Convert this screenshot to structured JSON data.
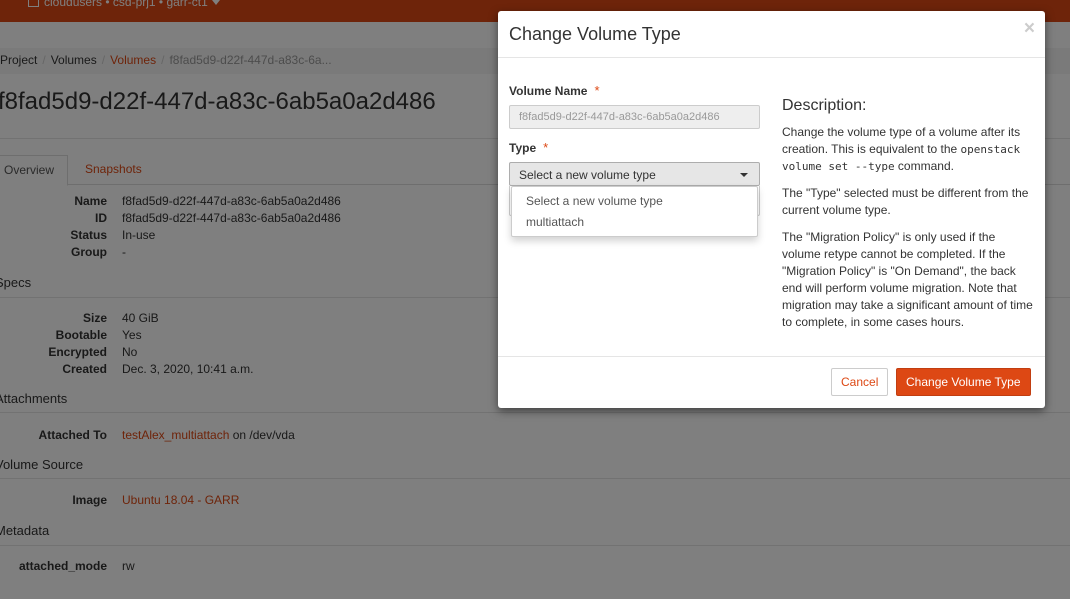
{
  "topbar": {
    "context": "cloudusers • csd-prj1 • garr-ct1"
  },
  "breadcrumb": {
    "items": [
      "Project",
      "Volumes",
      "Volumes"
    ],
    "current": "f8fad5d9-d22f-447d-a83c-6a..."
  },
  "page_title": "f8fad5d9-d22f-447d-a83c-6ab5a0a2d486",
  "tabs": {
    "overview": "Overview",
    "snapshots": "Snapshots"
  },
  "overview": {
    "name_label": "Name",
    "name_value": "f8fad5d9-d22f-447d-a83c-6ab5a0a2d486",
    "id_label": "ID",
    "id_value": "f8fad5d9-d22f-447d-a83c-6ab5a0a2d486",
    "status_label": "Status",
    "status_value": "In-use",
    "group_label": "Group",
    "group_value": "-",
    "specs_heading": "Specs",
    "size_label": "Size",
    "size_value": "40 GiB",
    "bootable_label": "Bootable",
    "bootable_value": "Yes",
    "encrypted_label": "Encrypted",
    "encrypted_value": "No",
    "created_label": "Created",
    "created_value": "Dec. 3, 2020, 10:41 a.m.",
    "attachments_heading": "Attachments",
    "attached_to_label": "Attached To",
    "attached_to_link": "testAlex_multiattach",
    "attached_to_suffix": " on /dev/vda",
    "volume_source_heading": "Volume Source",
    "image_label": "Image",
    "image_link": "Ubuntu 18.04 - GARR",
    "metadata_heading": "Metadata",
    "attached_mode_label": "attached_mode",
    "attached_mode_value": "rw"
  },
  "modal": {
    "title": "Change Volume Type",
    "close": "×",
    "volume_name_label": "Volume Name",
    "volume_name_value": "f8fad5d9-d22f-447d-a83c-6ab5a0a2d486",
    "required_marker": "*",
    "type_label": "Type",
    "type_selected": "Select a new volume type",
    "type_options": [
      "Select a new volume type",
      "multiattach"
    ],
    "description_heading": "Description:",
    "desc_p1_a": "Change the volume type of a volume after its creation. This is equivalent to the ",
    "desc_p1_code": "openstack volume set --type",
    "desc_p1_b": " command.",
    "desc_p2": "The \"Type\" selected must be different from the current volume type.",
    "desc_p3": "The \"Migration Policy\" is only used if the volume retype cannot be completed. If the \"Migration Policy\" is \"On Demand\", the back end will perform volume migration. Note that migration may take a significant amount of time to complete, in some cases hours.",
    "cancel": "Cancel",
    "submit": "Change Volume Type"
  },
  "colors": {
    "brand": "#dd4814",
    "backdrop": "rgba(0,0,0,0.5)"
  }
}
